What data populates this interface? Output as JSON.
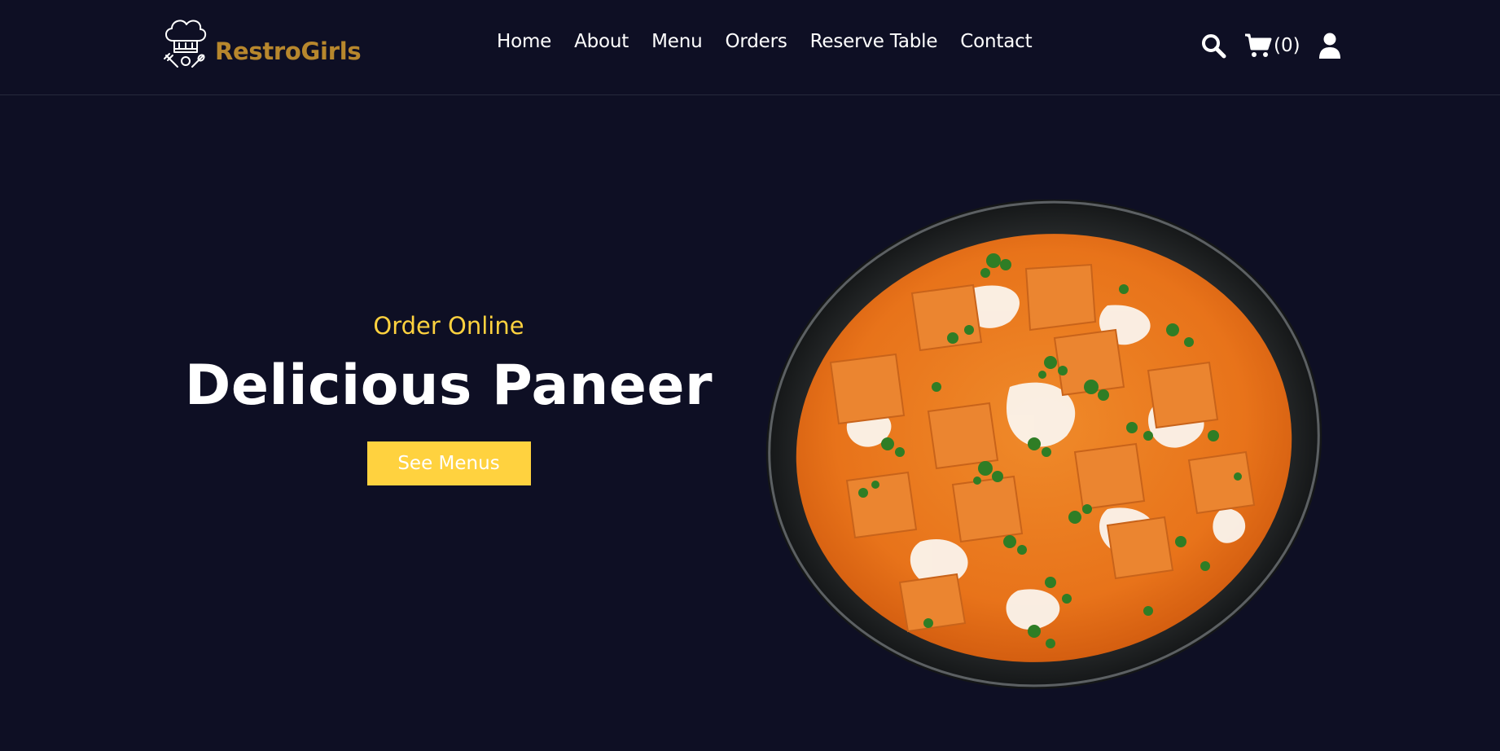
{
  "header": {
    "brand": "RestroGirls",
    "brand_icon": "chef-hat-icon",
    "brand_color": "#b7872d",
    "nav": [
      {
        "label": "Home"
      },
      {
        "label": "About"
      },
      {
        "label": "Menu"
      },
      {
        "label": "Orders"
      },
      {
        "label": "Reserve Table"
      },
      {
        "label": "Contact"
      }
    ],
    "actions": {
      "search_icon": "search-icon",
      "cart_icon": "shopping-cart-icon",
      "cart_count": "(0)",
      "user_icon": "user-icon"
    }
  },
  "hero": {
    "subtitle": "Order Online",
    "title": "Delicious Paneer",
    "button_label": "See Menus",
    "accent_color": "#ffd23f",
    "image": "paneer-dish-image"
  },
  "colors": {
    "background": "#0e0f24",
    "text": "#ffffff"
  }
}
